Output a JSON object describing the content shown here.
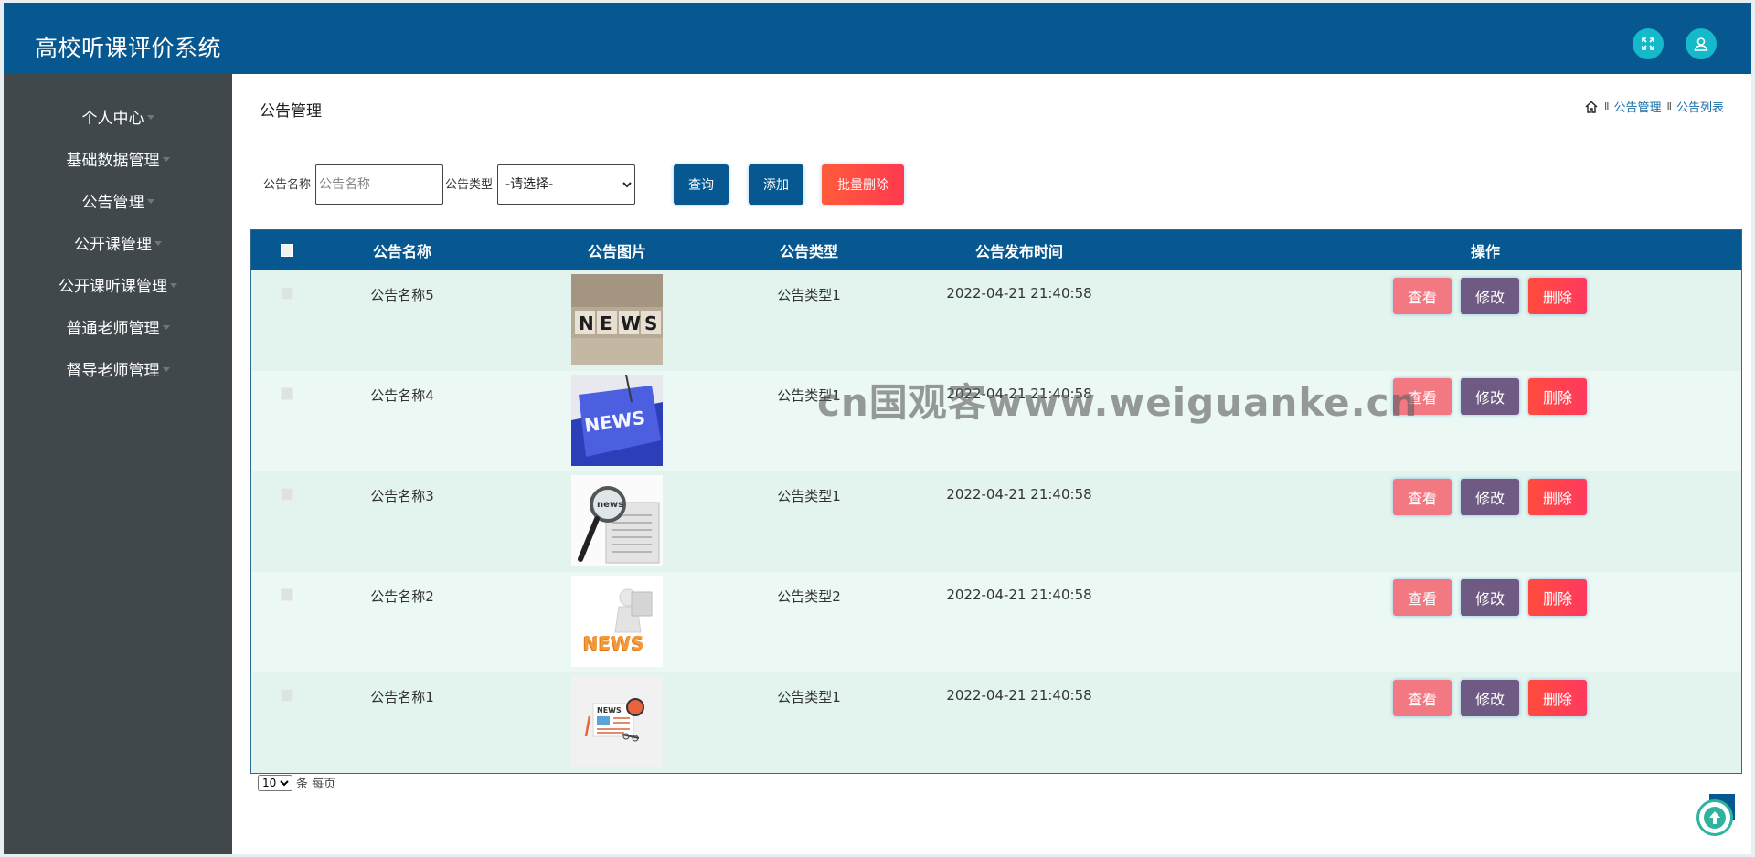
{
  "app": {
    "title": "高校听课评价系统"
  },
  "header": {
    "fullscreen_icon": "expand-icon",
    "user_icon": "user-icon"
  },
  "sidebar": {
    "items": [
      {
        "label": "个人中心"
      },
      {
        "label": "基础数据管理"
      },
      {
        "label": "公告管理"
      },
      {
        "label": "公开课管理"
      },
      {
        "label": "公开课听课管理"
      },
      {
        "label": "普通老师管理"
      },
      {
        "label": "督导老师管理"
      }
    ]
  },
  "page": {
    "title": "公告管理",
    "breadcrumb": {
      "sep": "II",
      "level1": "公告管理",
      "level2": "公告列表"
    }
  },
  "search": {
    "name_label": "公告名称",
    "name_placeholder": "公告名称",
    "type_label": "公告类型",
    "type_selected": "-请选择-",
    "query_label": "查询",
    "add_label": "添加",
    "batch_delete_label": "批量删除"
  },
  "table": {
    "columns": [
      "公告名称",
      "公告图片",
      "公告类型",
      "公告发布时间",
      "操作"
    ],
    "rows": [
      {
        "name": "公告名称5",
        "image": "news-blocks",
        "type": "公告类型1",
        "time": "2022-04-21 21:40:58"
      },
      {
        "name": "公告名称4",
        "image": "news-keyboard-key",
        "type": "公告类型1",
        "time": "2022-04-21 21:40:58"
      },
      {
        "name": "公告名称3",
        "image": "news-magnifier",
        "type": "公告类型1",
        "time": "2022-04-21 21:40:58"
      },
      {
        "name": "公告名称2",
        "image": "news-figure",
        "type": "公告类型2",
        "time": "2022-04-21 21:40:58"
      },
      {
        "name": "公告名称1",
        "image": "news-flat-illustration",
        "type": "公告类型1",
        "time": "2022-04-21 21:40:58"
      }
    ],
    "actions": {
      "view": "查看",
      "edit": "修改",
      "delete": "删除"
    }
  },
  "pager": {
    "page_size": "10",
    "suffix": "条 每页"
  },
  "watermark": {
    "text": "cn国观客www.weiguanke.cn"
  },
  "colors": {
    "primary": "#075890",
    "sidebar": "#40484c",
    "row": "#e8f7f1",
    "danger": "#ff4b3e",
    "view": "#f27882",
    "edit": "#6e5a83"
  }
}
